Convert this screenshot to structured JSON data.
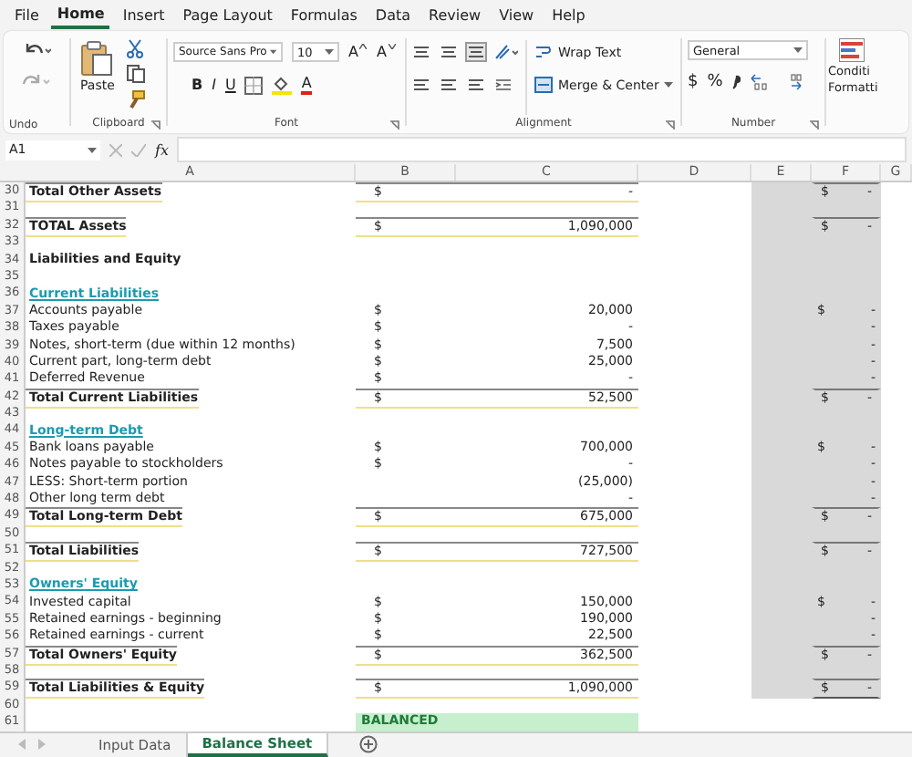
{
  "menu_tabs": [
    {
      "label": "File",
      "selected": false
    },
    {
      "label": "Home",
      "selected": true
    },
    {
      "label": "Insert",
      "selected": false
    },
    {
      "label": "Page Layout",
      "selected": false
    },
    {
      "label": "Formulas",
      "selected": false
    },
    {
      "label": "Data",
      "selected": false
    },
    {
      "label": "Review",
      "selected": false
    },
    {
      "label": "View",
      "selected": false
    },
    {
      "label": "Help",
      "selected": false
    }
  ],
  "ribbon": {
    "undo": {
      "label": "Undo"
    },
    "clipboard": {
      "paste": "Paste",
      "label": "Clipboard"
    },
    "font": {
      "name": "Source Sans Pro",
      "size": "10",
      "grow": "A",
      "shrink": "A",
      "bold": "B",
      "italic": "I",
      "underline": "U",
      "font_color": "A",
      "label": "Font"
    },
    "alignment": {
      "wrap": "Wrap Text",
      "merge": "Merge & Center",
      "label": "Alignment"
    },
    "number": {
      "format": "General",
      "currency": "$",
      "percent": "%",
      "label": "Number"
    },
    "styles": {
      "line1": "Conditi",
      "line2": "Formatti"
    }
  },
  "formula_bar": {
    "name_box": "A1",
    "fx": "fx"
  },
  "columns": [
    "A",
    "B",
    "C",
    "D",
    "E",
    "F",
    "G"
  ],
  "rows": [
    {
      "num": "30",
      "kind": "total",
      "label": "Total Other Assets",
      "b": "$",
      "c": "-",
      "shaded": true,
      "f_dollar": "$",
      "f_value": "-"
    },
    {
      "num": "31",
      "kind": "blank",
      "shaded": true
    },
    {
      "num": "32",
      "kind": "total",
      "label": "TOTAL Assets",
      "b": "$",
      "c": "1,090,000",
      "shaded": true,
      "f_dollar": "$",
      "f_value": "-"
    },
    {
      "num": "33",
      "kind": "blank",
      "shaded": true
    },
    {
      "num": "34",
      "kind": "bold",
      "label": "Liabilities and Equity",
      "shaded": true
    },
    {
      "num": "35",
      "kind": "blank",
      "shaded": true
    },
    {
      "num": "36",
      "kind": "section",
      "label": "Current Liabilities",
      "shaded": true
    },
    {
      "num": "37",
      "kind": "item",
      "label": "Accounts payable",
      "b": "$",
      "c": "20,000",
      "shaded": true,
      "f_dollar": "$",
      "f_value": "-"
    },
    {
      "num": "38",
      "kind": "item",
      "label": "Taxes payable",
      "b": "$",
      "c": "-",
      "shaded": true,
      "f_value": "-"
    },
    {
      "num": "39",
      "kind": "item",
      "label": "Notes, short-term (due within 12 months)",
      "b": "$",
      "c": "7,500",
      "shaded": true,
      "f_value": "-"
    },
    {
      "num": "40",
      "kind": "item",
      "label": "Current part, long-term debt",
      "b": "$",
      "c": "25,000",
      "shaded": true,
      "f_value": "-"
    },
    {
      "num": "41",
      "kind": "item",
      "label": "Deferred Revenue",
      "b": "$",
      "c": "-",
      "shaded": true,
      "f_value": "-"
    },
    {
      "num": "42",
      "kind": "total",
      "label": "Total Current Liabilities",
      "b": "$",
      "c": "52,500",
      "shaded": true,
      "f_dollar": "$",
      "f_value": "-"
    },
    {
      "num": "43",
      "kind": "blank",
      "shaded": true
    },
    {
      "num": "44",
      "kind": "section",
      "label": "Long-term Debt",
      "shaded": true
    },
    {
      "num": "45",
      "kind": "item",
      "label": "Bank loans payable",
      "b": "$",
      "c": "700,000",
      "shaded": true,
      "f_dollar": "$",
      "f_value": "-"
    },
    {
      "num": "46",
      "kind": "item",
      "label": "Notes payable to stockholders",
      "b": "$",
      "c": "-",
      "shaded": true,
      "f_value": "-"
    },
    {
      "num": "47",
      "kind": "item",
      "label": "LESS: Short-term portion",
      "c": "(25,000)",
      "shaded": true,
      "f_value": "-"
    },
    {
      "num": "48",
      "kind": "item",
      "label": "Other long term debt",
      "c": "-",
      "shaded": true,
      "f_value": "-"
    },
    {
      "num": "49",
      "kind": "total",
      "label": "Total Long-term Debt",
      "b": "$",
      "c": "675,000",
      "shaded": true,
      "f_dollar": "$",
      "f_value": "-"
    },
    {
      "num": "50",
      "kind": "blank",
      "shaded": true
    },
    {
      "num": "51",
      "kind": "total",
      "label": "Total Liabilities",
      "b": "$",
      "c": "727,500",
      "shaded": true,
      "f_dollar": "$",
      "f_value": "-"
    },
    {
      "num": "52",
      "kind": "blank",
      "shaded": true
    },
    {
      "num": "53",
      "kind": "section",
      "label": "Owners' Equity",
      "shaded": true
    },
    {
      "num": "54",
      "kind": "item",
      "label": "Invested capital",
      "b": "$",
      "c": "150,000",
      "shaded": true,
      "f_dollar": "$",
      "f_value": "-"
    },
    {
      "num": "55",
      "kind": "item",
      "label": "Retained earnings - beginning",
      "b": "$",
      "c": "190,000",
      "shaded": true,
      "f_value": "-"
    },
    {
      "num": "56",
      "kind": "item",
      "label": "Retained earnings - current",
      "b": "$",
      "c": "22,500",
      "shaded": true,
      "f_value": "-"
    },
    {
      "num": "57",
      "kind": "total",
      "label": "Total Owners' Equity",
      "b": "$",
      "c": "362,500",
      "shaded": true,
      "f_dollar": "$",
      "f_value": "-"
    },
    {
      "num": "58",
      "kind": "blank",
      "shaded": true
    },
    {
      "num": "59",
      "kind": "total",
      "label": "Total Liabilities & Equity",
      "b": "$",
      "c": "1,090,000",
      "shaded": true,
      "f_dollar": "$",
      "f_value": "-"
    },
    {
      "num": "60",
      "kind": "blank",
      "shaded": false
    },
    {
      "num": "61",
      "kind": "status",
      "status": "BALANCED",
      "shaded": false
    }
  ],
  "sheet_tabs": [
    {
      "label": "Input Data",
      "selected": false
    },
    {
      "label": "Balance Sheet",
      "selected": true
    }
  ]
}
